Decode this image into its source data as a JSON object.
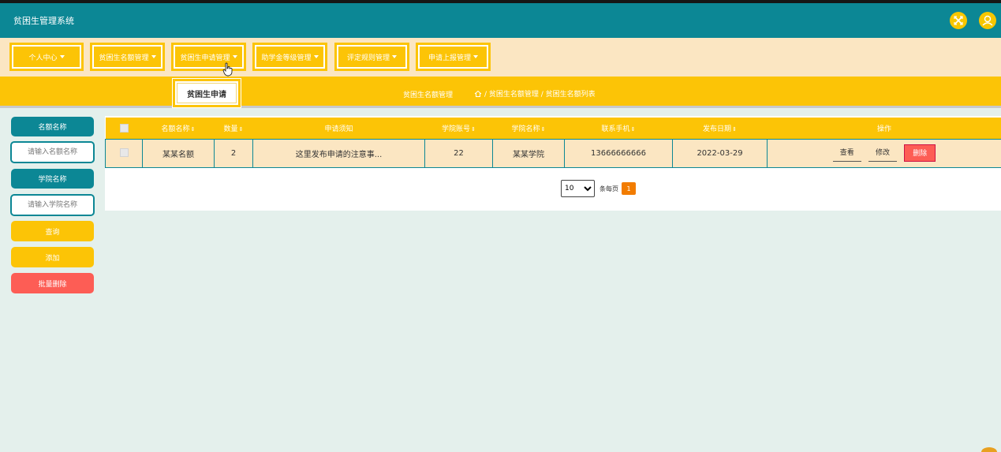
{
  "header": {
    "app_title": "贫困生管理系统",
    "icons": [
      "expand-icon",
      "user-avatar-icon"
    ],
    "accent": "#0c8795"
  },
  "menu": {
    "items": [
      {
        "label": "个人中心"
      },
      {
        "label": "贫困生名额管理"
      },
      {
        "label": "贫困生申请管理"
      },
      {
        "label": "助学金等级管理"
      },
      {
        "label": "评定规则管理"
      },
      {
        "label": "申请上报管理"
      }
    ]
  },
  "tabs": {
    "active": "贫困生申请"
  },
  "breadcrumb": {
    "page_name": "贫困生名额管理",
    "path": "/ 贫困生名额管理 / 贫困生名额列表"
  },
  "sidebar": {
    "quota_name_label": "名额名称",
    "quota_name_placeholder": "请输入名额名称",
    "college_name_label": "学院名称",
    "college_name_placeholder": "请输入学院名称",
    "search_button": "查询",
    "add_button": "添加",
    "batch_delete_button": "批量删除"
  },
  "table": {
    "headers": [
      "名额名称",
      "数量",
      "申请须知",
      "学院账号",
      "学院名称",
      "联系手机",
      "发布日期",
      "操作"
    ],
    "sortable": [
      "名额名称",
      "数量",
      "学院账号",
      "学院名称",
      "联系手机",
      "发布日期"
    ],
    "rows": [
      {
        "quota_name": "某某名额",
        "count": "2",
        "notice": "这里发布申请的注意事...",
        "college_account": "22",
        "college_name": "某某学院",
        "phone": "13666666666",
        "date": "2022-03-29"
      }
    ],
    "actions": {
      "view": "查看",
      "edit": "修改",
      "delete": "删除"
    }
  },
  "pagination": {
    "page_size": "10",
    "page_size_options": [
      "10"
    ],
    "per_page_label": "条每页",
    "current_page": "1"
  },
  "colors": {
    "yellow": "#fcc406",
    "teal": "#0c8795",
    "cream": "#fbe6c2",
    "danger": "#fd5d55",
    "orange": "#f27c00"
  }
}
